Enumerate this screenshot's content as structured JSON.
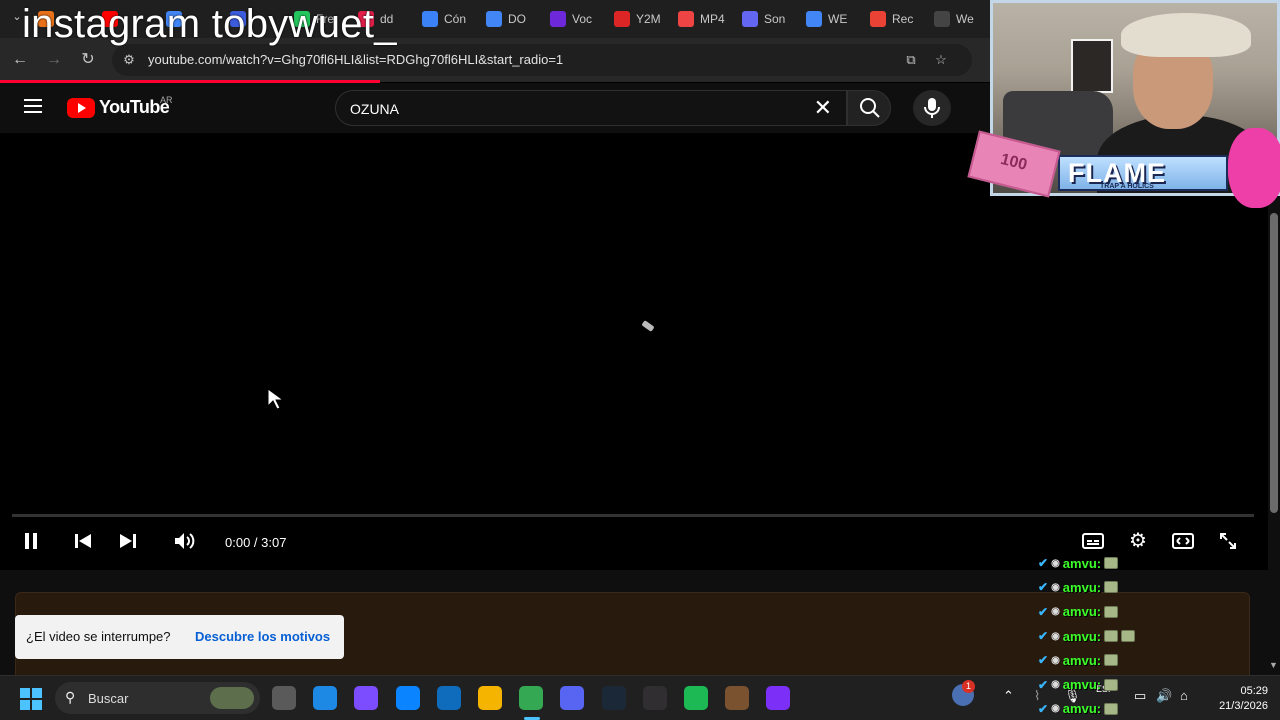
{
  "watermark": "instagram tobywuet_",
  "tabs": [
    {
      "label": "",
      "color": "#e8711a"
    },
    {
      "label": "",
      "color": "#ff0000"
    },
    {
      "label": "",
      "color": "#4285f4"
    },
    {
      "label": "",
      "color": "#3c5bdd"
    },
    {
      "label": "Fre",
      "color": "#22c55e"
    },
    {
      "label": "dd",
      "color": "#e11d48"
    },
    {
      "label": "Cón",
      "color": "#3b82f6"
    },
    {
      "label": "DO",
      "color": "#4285f4"
    },
    {
      "label": "Voc",
      "color": "#6d28d9"
    },
    {
      "label": "Y2M",
      "color": "#dc2626"
    },
    {
      "label": "MP4",
      "color": "#ef4444"
    },
    {
      "label": "Son",
      "color": "#6366f1"
    },
    {
      "label": "WE",
      "color": "#4285f4"
    },
    {
      "label": "Rec",
      "color": "#ea4335"
    },
    {
      "label": "We",
      "color": "#444444"
    }
  ],
  "browser": {
    "url": "youtube.com/watch?v=Ghg70fl6HLI&list=RDGhg70fl6HLI&start_radio=1"
  },
  "youtube": {
    "brand": "YouTube",
    "region": "AR",
    "search_value": "OZUNA"
  },
  "player": {
    "time": "0:00 / 3:07",
    "progress": 0
  },
  "toast": {
    "message": "¿El video se interrumpe?",
    "link": "Descubre los motivos"
  },
  "stream": {
    "banner_title": "FLAME",
    "banner_sub": "TRAP A HOLICS",
    "money_label": "100"
  },
  "chat": [
    {
      "user": "amvu:",
      "emotes": 1
    },
    {
      "user": "amvu:",
      "emotes": 1
    },
    {
      "user": "amvu:",
      "emotes": 1
    },
    {
      "user": "amvu:",
      "emotes": 2
    },
    {
      "user": "amvu:",
      "emotes": 1
    },
    {
      "user": "amvu:",
      "emotes": 1
    },
    {
      "user": "amvu:",
      "emotes": 1
    }
  ],
  "taskbar": {
    "search_label": "Buscar",
    "apps": [
      {
        "name": "task-view",
        "color": "#5a5a5a"
      },
      {
        "name": "edge",
        "color": "#1e88e5"
      },
      {
        "name": "copilot",
        "color": "#7c4dff"
      },
      {
        "name": "store",
        "color": "#0a84ff"
      },
      {
        "name": "outlook",
        "color": "#0f6cbd"
      },
      {
        "name": "explorer",
        "color": "#f4b400"
      },
      {
        "name": "chrome",
        "color": "#34a853"
      },
      {
        "name": "discord",
        "color": "#5865f2"
      },
      {
        "name": "steam",
        "color": "#1b2838"
      },
      {
        "name": "obs",
        "color": "#302e31"
      },
      {
        "name": "spotify",
        "color": "#1db954"
      },
      {
        "name": "minecraft",
        "color": "#7a5230"
      },
      {
        "name": "clipchamp",
        "color": "#7b2ff7"
      }
    ],
    "lang": "ESP",
    "notification_count": "1",
    "time": "05:29",
    "date": "21/3/2026"
  }
}
